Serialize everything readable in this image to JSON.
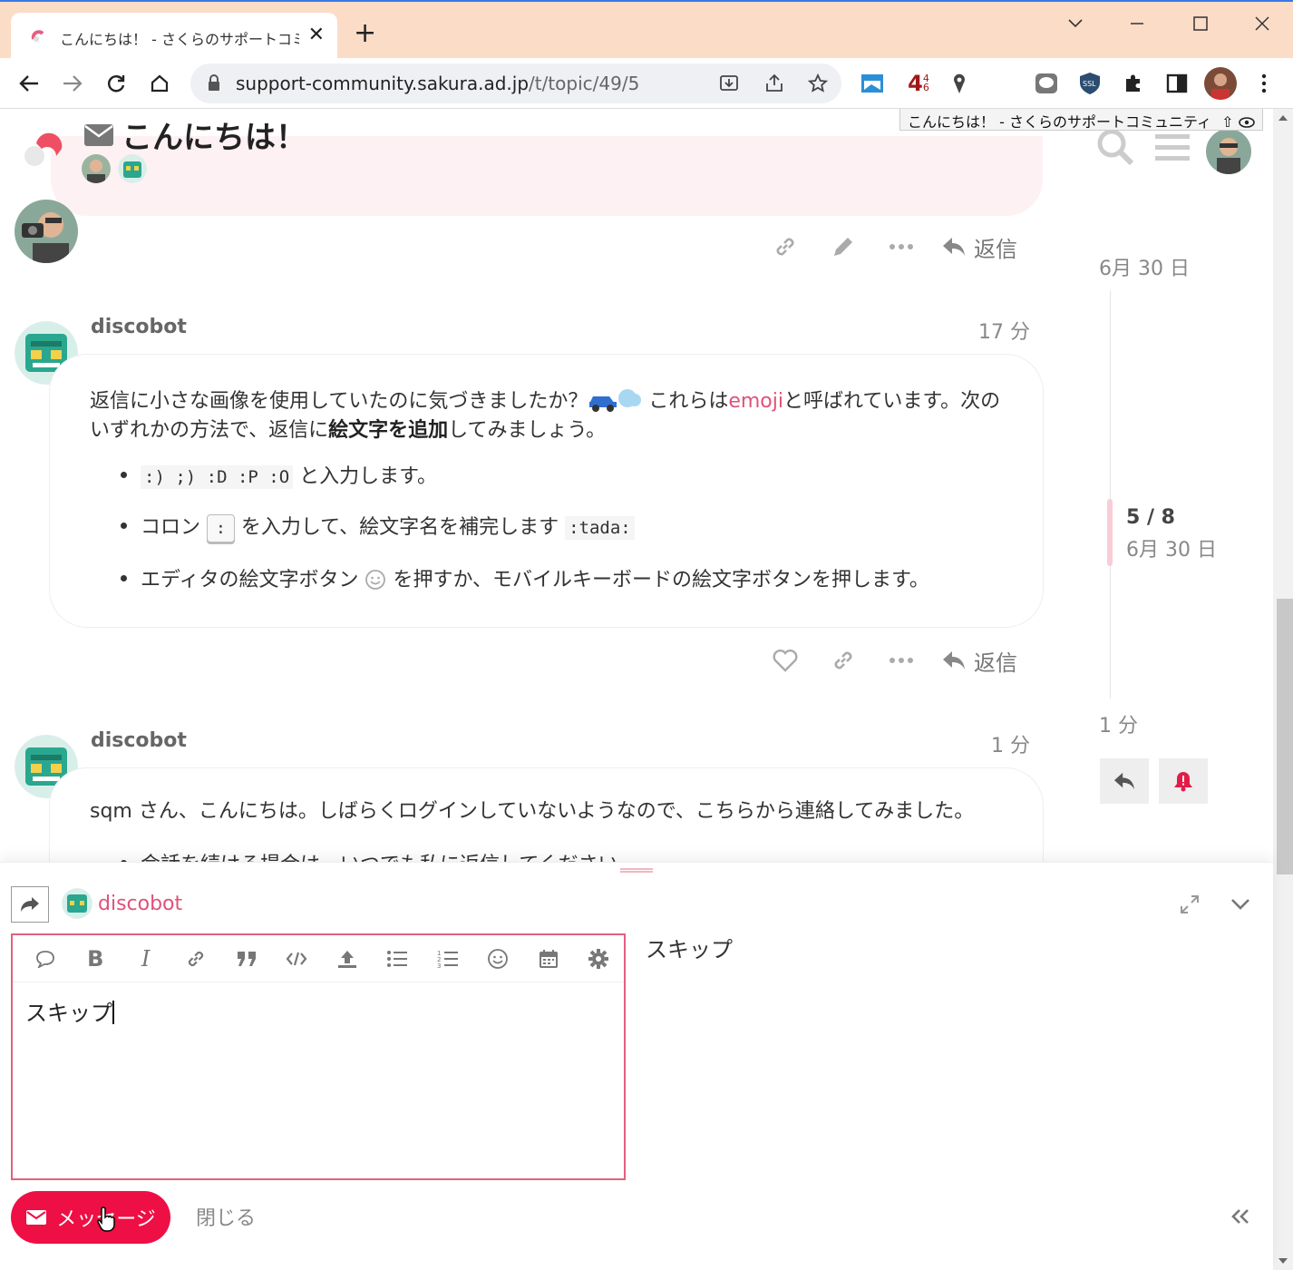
{
  "browser": {
    "tab_title": "こんにちは！ - さくらのサポートコミュニティ",
    "new_tab_label": "+",
    "url_host": "support-community.sakura.ad.jp",
    "url_path": "/t/topic/49/5",
    "ext_badge": "4",
    "ext_badge_sub": "6",
    "window_controls": [
      "minimize",
      "maximize",
      "close"
    ]
  },
  "tooltip": "こんにちは！ - さくらのサポートコミュニティ",
  "header": {
    "topic_title": "こんにちは！",
    "accent_color": "#e45f82"
  },
  "prev_post": {
    "reply_label": "返信"
  },
  "post1": {
    "username": "discobot",
    "time": "17 分",
    "para_a": "返信に小さな画像を使用していたのに気づきましたか？",
    "para_b": " これらは",
    "link": "emoji",
    "para_c": "と呼ばれています。次のいずれかの方法で、返信に",
    "bold": "絵文字を追加",
    "para_d": "してみましょう。",
    "bullet1_code": ":) ;) :D :P :O",
    "bullet1_text": " と入力します。",
    "bullet2_a": "コロン ",
    "bullet2_kbd": ":",
    "bullet2_b": " を入力して、絵文字名を補完します ",
    "bullet2_code": ":tada:",
    "bullet3_a": "エディタの絵文字ボタン ",
    "bullet3_b": " を押すか、モバイルキーボードの絵文字ボタンを押します。",
    "reply_label": "返信"
  },
  "post2": {
    "username": "discobot",
    "time": "1 分",
    "text": "sqm さん、こんにちは。しばらくログインしていないようなので、こちらから連絡してみました。",
    "bullet1": "会話を続ける場合は、いつでも私に返信してください。"
  },
  "timeline": {
    "start_date": "6月 30 日",
    "position": "5 / 8",
    "position_date": "6月 30 日",
    "end_label": "1 分"
  },
  "composer": {
    "recipient": "discobot",
    "editor_text": "スキップ",
    "preview_text": "スキップ",
    "submit_label": "メッセージ",
    "cancel_label": "閉じる"
  }
}
